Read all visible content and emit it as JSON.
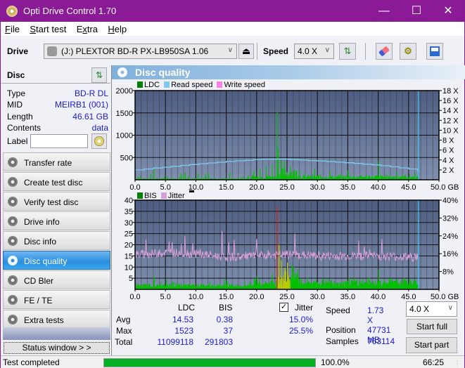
{
  "window": {
    "title": "Opti Drive Control 1.70",
    "minimize": "—",
    "maximize": "☐",
    "close": "✕"
  },
  "menu": [
    "File",
    "Start test",
    "Extra",
    "Help"
  ],
  "menu_underline": [
    "F",
    "S",
    "x",
    "H"
  ],
  "toolbar": {
    "drive_label": "Drive",
    "drive_value": "(J:)  PLEXTOR BD-R  PX-LB950SA 1.06",
    "speed_label": "Speed",
    "speed_value": "4.0 X",
    "icons": [
      "eject-icon",
      "refresh-icon",
      "erase-icon",
      "settings-icon",
      "save-icon"
    ]
  },
  "disc": {
    "title": "Disc",
    "rows": [
      {
        "label": "Type",
        "value": "BD-R DL"
      },
      {
        "label": "MID",
        "value": "MEIRB1 (001)"
      },
      {
        "label": "Length",
        "value": "46.61 GB"
      },
      {
        "label": "Contents",
        "value": "data"
      }
    ],
    "label_field_label": "Label",
    "label_field_value": ""
  },
  "nav": [
    {
      "label": "Transfer rate",
      "active": false
    },
    {
      "label": "Create test disc",
      "active": false
    },
    {
      "label": "Verify test disc",
      "active": false
    },
    {
      "label": "Drive info",
      "active": false
    },
    {
      "label": "Disc info",
      "active": false
    },
    {
      "label": "Disc quality",
      "active": true
    },
    {
      "label": "CD Bler",
      "active": false
    },
    {
      "label": "FE / TE",
      "active": false
    },
    {
      "label": "Extra tests",
      "active": false
    }
  ],
  "status_window_button": "Status window > >",
  "panel_title": "Disc quality",
  "colors": {
    "ldc": "#00c000",
    "bis": "#00c000",
    "read_speed": "#7ec8f2",
    "write_speed": "#ff80e0",
    "jitter": "#d8a0d8",
    "plot_bg_top": "#4d5c80",
    "plot_bg_bottom": "#8090b0",
    "accent": "#2b8ee0",
    "title_bar": "#8b1a96"
  },
  "chart_data": [
    {
      "type": "bar",
      "title": "LDC / Read speed",
      "legend": [
        "LDC",
        "Read speed",
        "Write speed"
      ],
      "legend_position": "top-left",
      "xlabel": "GB",
      "x_ticks": [
        "0.0",
        "5.0",
        "10.0",
        "15.0",
        "20.0",
        "25.0",
        "30.0",
        "35.0",
        "40.0",
        "45.0",
        "50.0 GB"
      ],
      "xlim": [
        0,
        50
      ],
      "y_ticks": [
        "500",
        "1000",
        "1500",
        "2000"
      ],
      "ylim": [
        0,
        2000
      ],
      "y2_ticks": [
        "2 X",
        "4 X",
        "6 X",
        "8 X",
        "10 X",
        "12 X",
        "14 X",
        "16 X",
        "18 X"
      ],
      "y2lim": [
        0,
        18
      ],
      "grid": true,
      "end_marker_gb": 46.61,
      "ldc_peaks": [
        {
          "x": 0.5,
          "y": 60
        },
        {
          "x": 3.0,
          "y": 250
        },
        {
          "x": 7.5,
          "y": 140
        },
        {
          "x": 8.2,
          "y": 160
        },
        {
          "x": 12.0,
          "y": 150
        },
        {
          "x": 15.5,
          "y": 160
        },
        {
          "x": 19.5,
          "y": 200
        },
        {
          "x": 20.5,
          "y": 250
        },
        {
          "x": 21.5,
          "y": 300
        },
        {
          "x": 22.5,
          "y": 350
        },
        {
          "x": 23.3,
          "y": 1523
        },
        {
          "x": 23.5,
          "y": 700
        },
        {
          "x": 24.0,
          "y": 450
        },
        {
          "x": 24.5,
          "y": 420
        },
        {
          "x": 25.5,
          "y": 300
        },
        {
          "x": 27.0,
          "y": 220
        },
        {
          "x": 29.5,
          "y": 250
        },
        {
          "x": 32.0,
          "y": 200
        },
        {
          "x": 35.0,
          "y": 220
        },
        {
          "x": 40.0,
          "y": 430
        },
        {
          "x": 43.0,
          "y": 180
        },
        {
          "x": 46.0,
          "y": 150
        }
      ],
      "series": [
        {
          "name": "Read speed",
          "x": [
            0,
            5,
            10,
            15,
            20,
            23.5,
            25,
            30,
            35,
            40,
            45,
            46.6
          ],
          "y": [
            2.0,
            2.6,
            3.2,
            3.7,
            4.1,
            4.2,
            4.1,
            3.8,
            3.4,
            2.9,
            2.2,
            1.73
          ]
        }
      ]
    },
    {
      "type": "bar",
      "title": "BIS / Jitter",
      "legend": [
        "BIS",
        "Jitter"
      ],
      "legend_position": "top-left",
      "xlabel": "GB",
      "x_ticks": [
        "0.0",
        "5.0",
        "10.0",
        "15.0",
        "20.0",
        "25.0",
        "30.0",
        "35.0",
        "40.0",
        "45.0",
        "50.0 GB"
      ],
      "xlim": [
        0,
        50
      ],
      "y_ticks": [
        "5",
        "10",
        "15",
        "20",
        "25",
        "30",
        "35",
        "40"
      ],
      "ylim": [
        0,
        40
      ],
      "y2_ticks": [
        "8%",
        "16%",
        "24%",
        "32%",
        "40%"
      ],
      "y2lim": [
        0,
        40
      ],
      "grid": true,
      "end_marker_gb": 46.61,
      "bis_peaks": [
        {
          "x": 3.0,
          "y": 6
        },
        {
          "x": 20.0,
          "y": 6
        },
        {
          "x": 22.5,
          "y": 7
        },
        {
          "x": 23.3,
          "y": 37
        },
        {
          "x": 23.6,
          "y": 20
        },
        {
          "x": 24.0,
          "y": 13
        },
        {
          "x": 25.0,
          "y": 12
        },
        {
          "x": 26.0,
          "y": 8
        },
        {
          "x": 40.0,
          "y": 9
        },
        {
          "x": 46.0,
          "y": 4
        }
      ],
      "series": [
        {
          "name": "Jitter (%)",
          "x": [
            0,
            5,
            10,
            15,
            20,
            25,
            30,
            35,
            40,
            45,
            46.6
          ],
          "y": [
            15.5,
            16.5,
            16.0,
            14.5,
            15.0,
            15.5,
            15.0,
            15.0,
            15.0,
            14.5,
            14.5
          ]
        }
      ]
    }
  ],
  "stats": {
    "col_headers": [
      "LDC",
      "BIS"
    ],
    "rows": [
      {
        "label": "Avg",
        "ldc": "14.53",
        "bis": "0.38",
        "jitter": "15.0%"
      },
      {
        "label": "Max",
        "ldc": "1523",
        "bis": "37",
        "jitter": "25.5%"
      },
      {
        "label": "Total",
        "ldc": "11099118",
        "bis": "291803",
        "jitter": ""
      }
    ],
    "jitter_label": "Jitter",
    "jitter_checked": true,
    "speed_label": "Speed",
    "speed_value": "1.73 X",
    "position_label": "Position",
    "position_value": "47731 MB",
    "samples_label": "Samples",
    "samples_value": "763114",
    "speed_select": "4.0 X",
    "start_full": "Start full",
    "start_part": "Start part"
  },
  "statusbar": {
    "text": "Test completed",
    "progress_percent": 100.0,
    "progress_text": "100.0%",
    "time": "66:25"
  }
}
